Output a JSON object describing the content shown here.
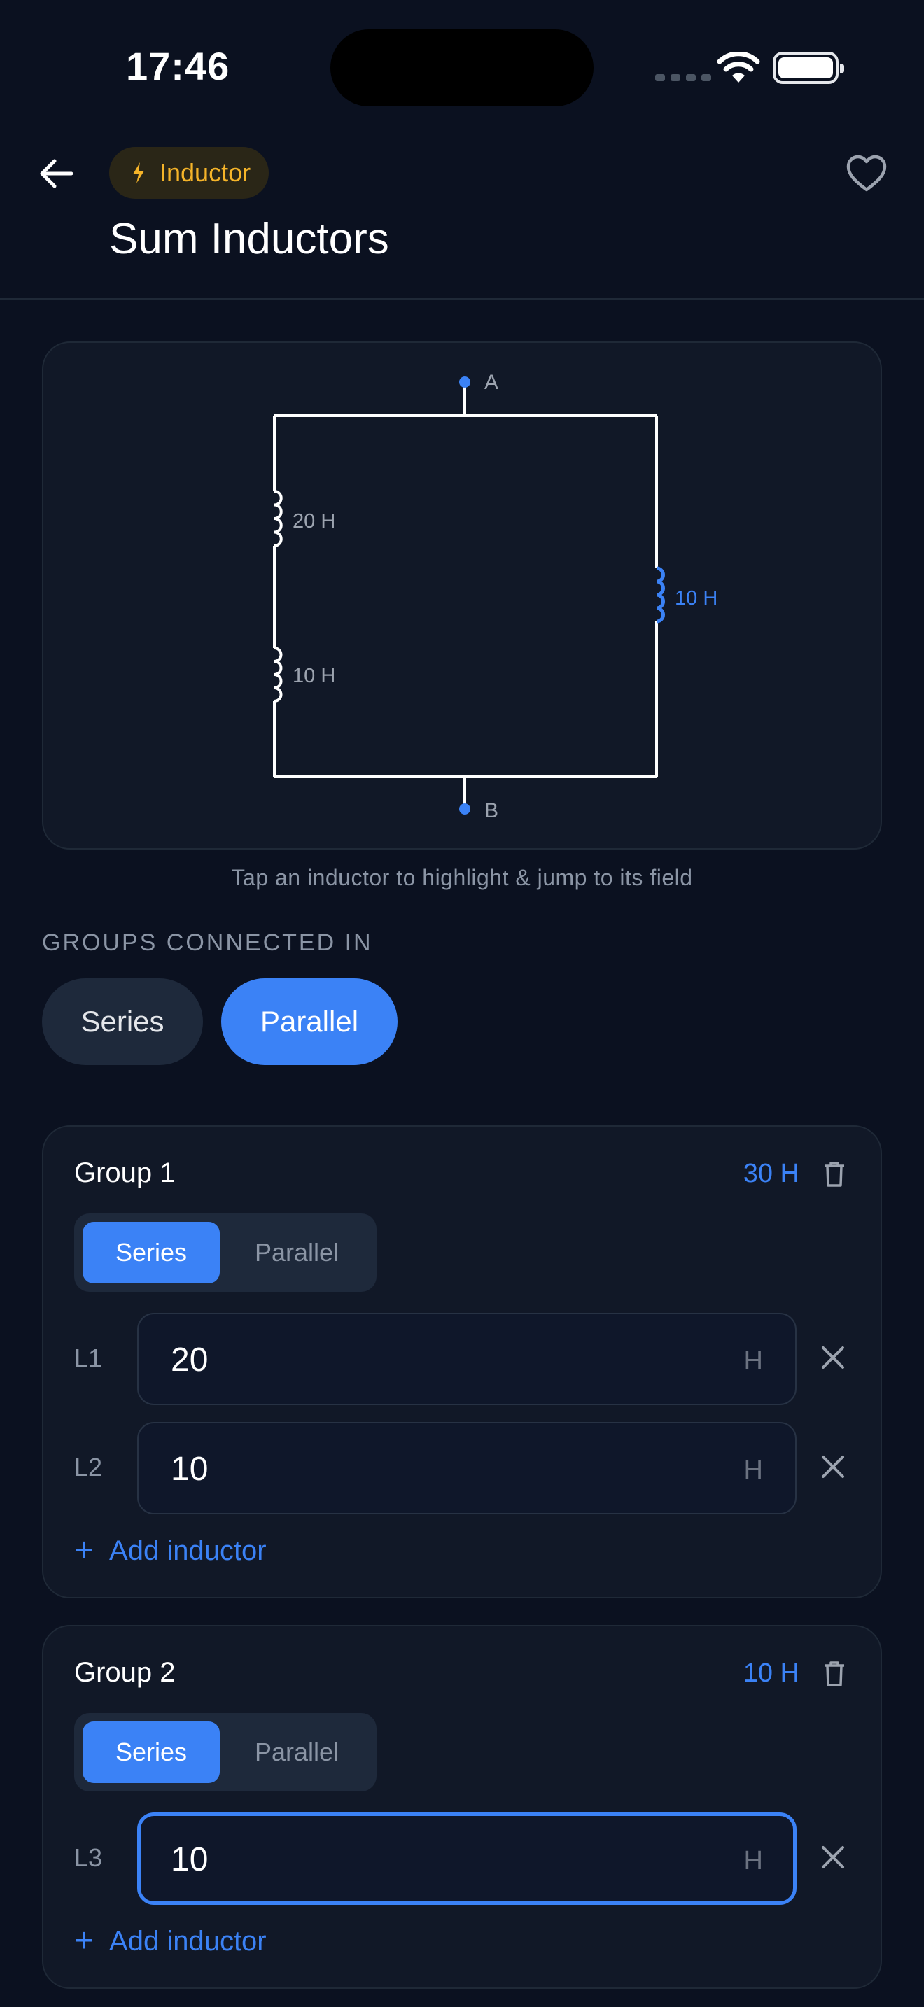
{
  "status": {
    "time": "17:46"
  },
  "header": {
    "tag_label": "Inductor",
    "title": "Sum Inductors"
  },
  "diagram": {
    "node_a": "A",
    "node_b": "B",
    "labels": {
      "l1": "20 H",
      "l2": "10 H",
      "l3": "10 H"
    },
    "hint": "Tap an inductor to highlight & jump to its field",
    "colors": {
      "wire": "#ffffff",
      "highlight": "#3b82f6",
      "label": "#9ca3af"
    }
  },
  "connection": {
    "label": "GROUPS CONNECTED IN",
    "options": [
      "Series",
      "Parallel"
    ],
    "selected": "Parallel"
  },
  "groups": [
    {
      "title": "Group 1",
      "total": "30 H",
      "mode_options": [
        "Series",
        "Parallel"
      ],
      "mode_selected": "Series",
      "inductors": [
        {
          "label": "L1",
          "value": "20",
          "unit": "H"
        },
        {
          "label": "L2",
          "value": "10",
          "unit": "H"
        }
      ],
      "add_label": "Add inductor"
    },
    {
      "title": "Group 2",
      "total": "10 H",
      "mode_options": [
        "Series",
        "Parallel"
      ],
      "mode_selected": "Series",
      "inductors": [
        {
          "label": "L3",
          "value": "10",
          "unit": "H",
          "focused": true
        }
      ],
      "add_label": "Add inductor"
    }
  ],
  "colors": {
    "accent": "#3b82f6",
    "tag": "#f5b429",
    "background": "#0b1120",
    "card": "#111827"
  }
}
